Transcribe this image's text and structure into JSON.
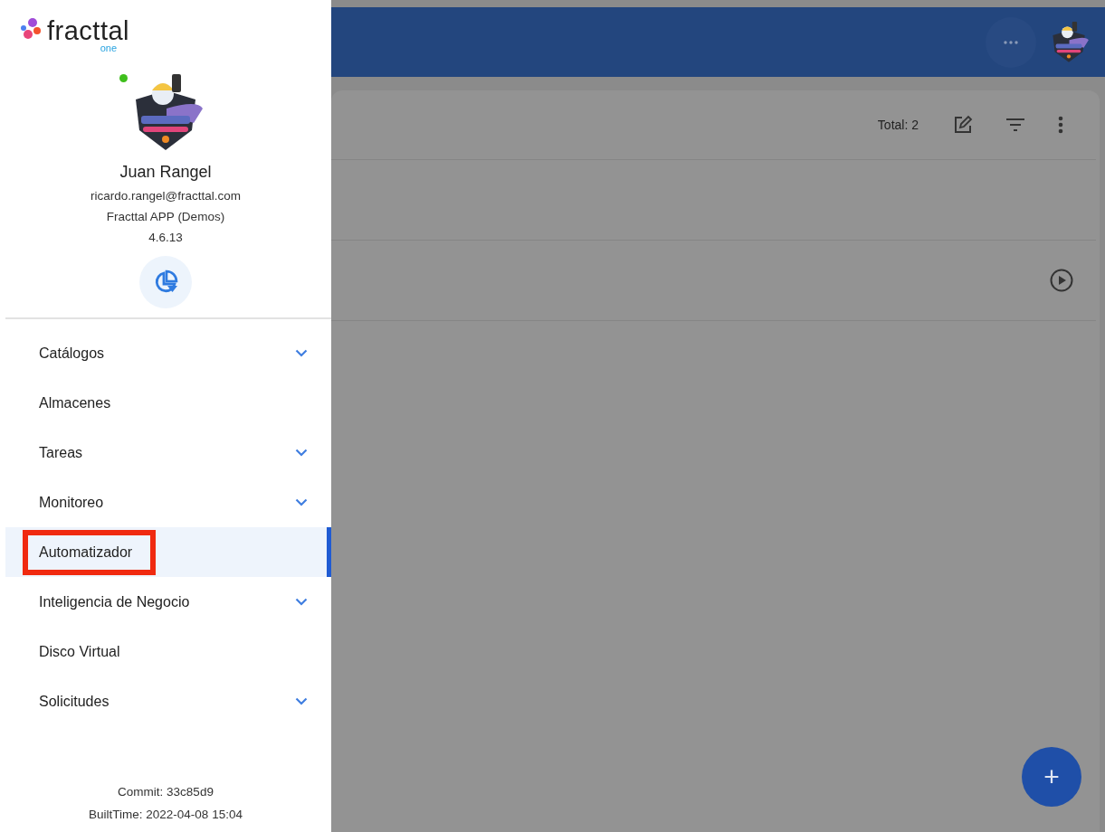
{
  "drawer": {
    "logo": {
      "name": "fracttal",
      "suffix": "one"
    },
    "profile": {
      "online": true,
      "name": "Juan Rangel",
      "email": "ricardo.rangel@fracttal.com",
      "company": "Fracttal APP (Demos)",
      "version": "4.6.13"
    },
    "menu": [
      {
        "label": "Catálogos",
        "expandable": true,
        "selected": false,
        "highlighted": false
      },
      {
        "label": "Almacenes",
        "expandable": false,
        "selected": false,
        "highlighted": false
      },
      {
        "label": "Tareas",
        "expandable": true,
        "selected": false,
        "highlighted": false
      },
      {
        "label": "Monitoreo",
        "expandable": true,
        "selected": false,
        "highlighted": false
      },
      {
        "label": "Automatizador",
        "expandable": false,
        "selected": true,
        "highlighted": true
      },
      {
        "label": "Inteligencia de Negocio",
        "expandable": true,
        "selected": false,
        "highlighted": false
      },
      {
        "label": "Disco Virtual",
        "expandable": false,
        "selected": false,
        "highlighted": false
      },
      {
        "label": "Solicitudes",
        "expandable": true,
        "selected": false,
        "highlighted": false
      }
    ],
    "footer": [
      "Commit: 33c85d9",
      "BuiltTime: 2022-04-08 15:04"
    ]
  },
  "main": {
    "total": "Total: 2",
    "fab": "+"
  }
}
